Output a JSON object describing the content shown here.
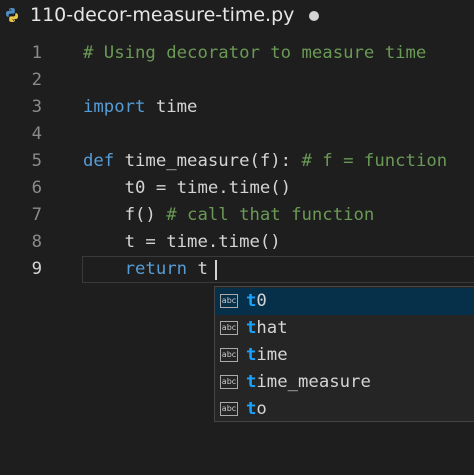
{
  "tab": {
    "file_icon": "python-icon",
    "title": "110-decor-measure-time.py",
    "dirty_indicator": "unsaved-dot"
  },
  "colors": {
    "background": "#1e1e1e",
    "keyword": "#569cd6",
    "comment": "#6a9955",
    "function": "#dcdcaa",
    "match_highlight": "#18a3ff",
    "selected_suggestion": "#062f4a"
  },
  "editor": {
    "active_line": 9,
    "lines": [
      {
        "num": "1",
        "tokens": [
          {
            "t": "cm",
            "v": "# Using decorator to measure time"
          }
        ]
      },
      {
        "num": "2",
        "tokens": []
      },
      {
        "num": "3",
        "tokens": [
          {
            "t": "kw",
            "v": "import"
          },
          {
            "t": "pl",
            "v": " time"
          }
        ]
      },
      {
        "num": "4",
        "tokens": []
      },
      {
        "num": "5",
        "tokens": [
          {
            "t": "kw",
            "v": "def"
          },
          {
            "t": "pl",
            "v": " time_measure(f): "
          },
          {
            "t": "cm",
            "v": "# f = function"
          }
        ]
      },
      {
        "num": "6",
        "tokens": [
          {
            "t": "pl",
            "v": "    t0 = time.time()"
          }
        ]
      },
      {
        "num": "7",
        "tokens": [
          {
            "t": "pl",
            "v": "    f() "
          },
          {
            "t": "cm",
            "v": "# call that function"
          }
        ]
      },
      {
        "num": "8",
        "tokens": [
          {
            "t": "pl",
            "v": "    t = time.time()"
          }
        ]
      },
      {
        "num": "9",
        "tokens": [
          {
            "t": "pl",
            "v": "    "
          },
          {
            "t": "kw",
            "v": "return"
          },
          {
            "t": "pl",
            "v": " t"
          }
        ]
      }
    ]
  },
  "suggestions": {
    "kind_icon": "abc",
    "items": [
      {
        "match": "t",
        "rest": "0",
        "selected": true
      },
      {
        "match": "t",
        "rest": "hat",
        "selected": false
      },
      {
        "match": "t",
        "rest": "ime",
        "selected": false
      },
      {
        "match": "t",
        "rest": "ime_measure",
        "selected": false
      },
      {
        "match": "t",
        "rest": "o",
        "selected": false
      }
    ]
  }
}
